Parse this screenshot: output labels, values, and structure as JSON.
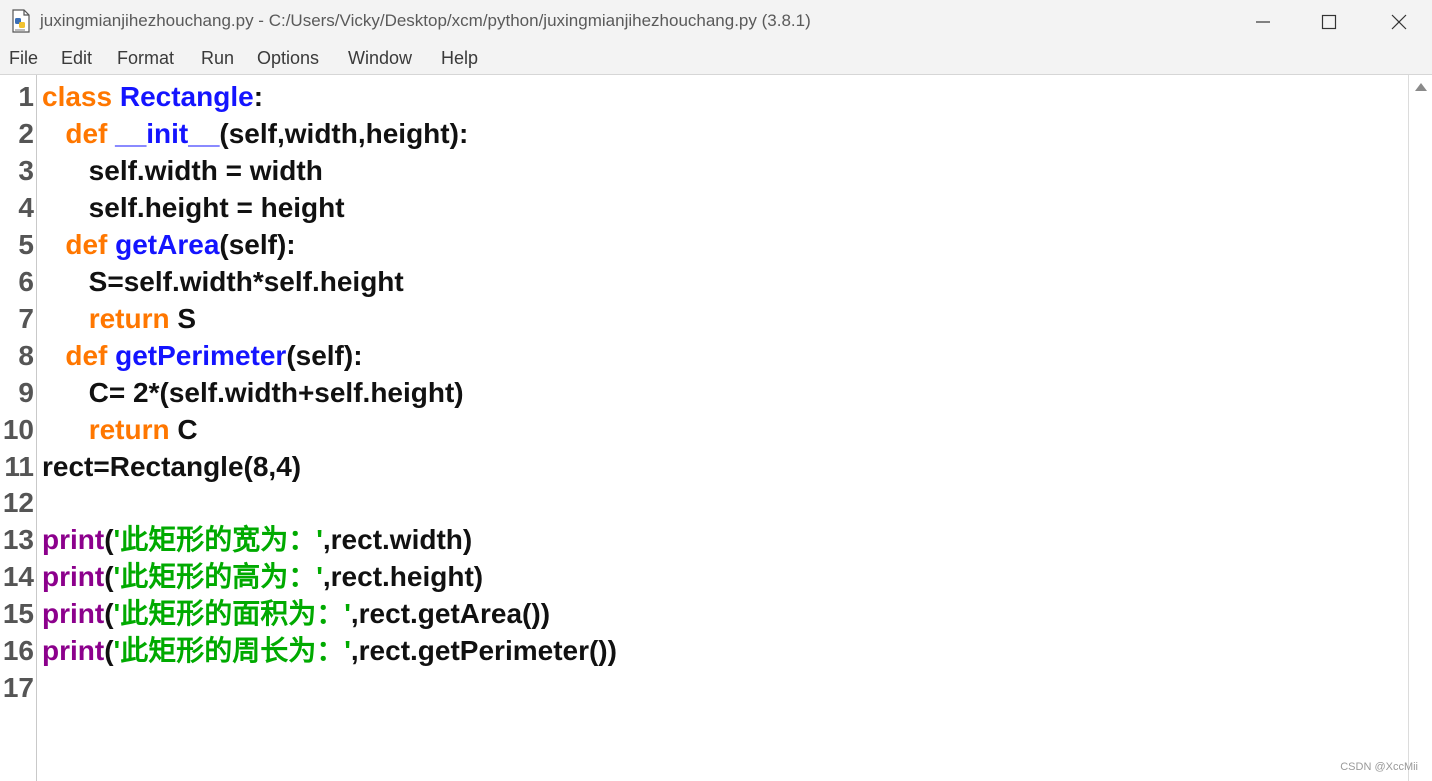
{
  "window": {
    "title": "juxingmianjihezhouchang.py - C:/Users/Vicky/Desktop/xcm/python/juxingmianjihezhouchang.py (3.8.1)"
  },
  "menu": [
    "File",
    "Edit",
    "Format",
    "Run",
    "Options",
    "Window",
    "Help"
  ],
  "colors": {
    "keyword": "#ff7700",
    "definition": "#1414ff",
    "builtin": "#8c008c",
    "string": "#00aa00",
    "text": "#111111"
  },
  "code": [
    {
      "no": "1",
      "tokens": [
        {
          "t": "class ",
          "c": "kw"
        },
        {
          "t": "Rectangle",
          "c": "def"
        },
        {
          "t": ":",
          "c": ""
        }
      ]
    },
    {
      "no": "2",
      "tokens": [
        {
          "t": "   ",
          "c": ""
        },
        {
          "t": "def ",
          "c": "kw"
        },
        {
          "t": "__init__",
          "c": "def"
        },
        {
          "t": "(self,width,height):",
          "c": ""
        }
      ]
    },
    {
      "no": "3",
      "tokens": [
        {
          "t": "      self.width = width",
          "c": ""
        }
      ]
    },
    {
      "no": "4",
      "tokens": [
        {
          "t": "      self.height = height",
          "c": ""
        }
      ]
    },
    {
      "no": "5",
      "tokens": [
        {
          "t": "   ",
          "c": ""
        },
        {
          "t": "def ",
          "c": "kw"
        },
        {
          "t": "getArea",
          "c": "def"
        },
        {
          "t": "(self):",
          "c": ""
        }
      ]
    },
    {
      "no": "6",
      "tokens": [
        {
          "t": "      S=self.width*self.height",
          "c": ""
        }
      ]
    },
    {
      "no": "7",
      "tokens": [
        {
          "t": "      ",
          "c": ""
        },
        {
          "t": "return",
          "c": "kw"
        },
        {
          "t": " S",
          "c": ""
        }
      ]
    },
    {
      "no": "8",
      "tokens": [
        {
          "t": "   ",
          "c": ""
        },
        {
          "t": "def ",
          "c": "kw"
        },
        {
          "t": "getPerimeter",
          "c": "def"
        },
        {
          "t": "(self):",
          "c": ""
        }
      ]
    },
    {
      "no": "9",
      "tokens": [
        {
          "t": "      C= 2*(self.width+self.height)",
          "c": ""
        }
      ]
    },
    {
      "no": "10",
      "tokens": [
        {
          "t": "      ",
          "c": ""
        },
        {
          "t": "return",
          "c": "kw"
        },
        {
          "t": " C",
          "c": ""
        }
      ]
    },
    {
      "no": "11",
      "tokens": [
        {
          "t": "rect=Rectangle(8,4)",
          "c": ""
        }
      ]
    },
    {
      "no": "12",
      "tokens": []
    },
    {
      "no": "13",
      "tokens": [
        {
          "t": "print",
          "c": "bi"
        },
        {
          "t": "(",
          "c": ""
        },
        {
          "t": "'此矩形的宽为：'",
          "c": "str"
        },
        {
          "t": ",rect.width)",
          "c": ""
        }
      ]
    },
    {
      "no": "14",
      "tokens": [
        {
          "t": "print",
          "c": "bi"
        },
        {
          "t": "(",
          "c": ""
        },
        {
          "t": "'此矩形的高为：'",
          "c": "str"
        },
        {
          "t": ",rect.height)",
          "c": ""
        }
      ]
    },
    {
      "no": "15",
      "tokens": [
        {
          "t": "print",
          "c": "bi"
        },
        {
          "t": "(",
          "c": ""
        },
        {
          "t": "'此矩形的面积为：'",
          "c": "str"
        },
        {
          "t": ",rect.getArea())",
          "c": ""
        }
      ]
    },
    {
      "no": "16",
      "tokens": [
        {
          "t": "print",
          "c": "bi"
        },
        {
          "t": "(",
          "c": ""
        },
        {
          "t": "'此矩形的周长为：'",
          "c": "str"
        },
        {
          "t": ",rect.getPerimeter())",
          "c": ""
        }
      ]
    },
    {
      "no": "17",
      "tokens": []
    }
  ],
  "watermark": "CSDN @XccMii"
}
